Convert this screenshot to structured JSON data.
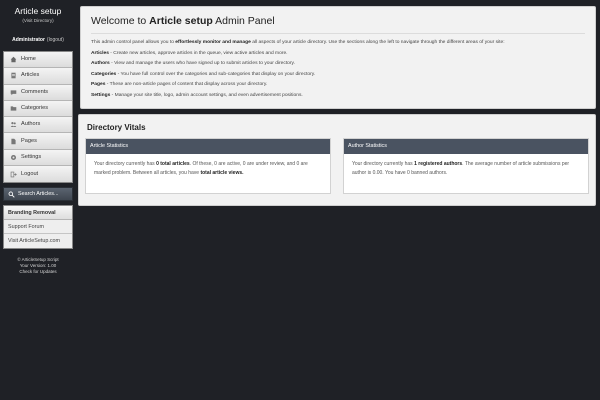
{
  "sidebar": {
    "title": "Article setup",
    "subtitle": "(Visit Directory)",
    "admin_label": "Administrator",
    "logout_label": "(logout)",
    "nav": [
      {
        "label": "Home",
        "icon": "home-icon"
      },
      {
        "label": "Articles",
        "icon": "document-icon"
      },
      {
        "label": "Comments",
        "icon": "comment-icon"
      },
      {
        "label": "Categories",
        "icon": "folder-icon"
      },
      {
        "label": "Authors",
        "icon": "users-icon"
      },
      {
        "label": "Pages",
        "icon": "page-icon"
      },
      {
        "label": "Settings",
        "icon": "gear-icon"
      },
      {
        "label": "Logout",
        "icon": "logout-icon"
      }
    ],
    "search_label": "Search Articles...",
    "branding": {
      "heading": "Branding Removal",
      "links": [
        "Support Forum",
        "Visit ArticleSetup.com"
      ]
    },
    "footer": {
      "copyright": "© ArticleSetup Script",
      "version": "Your Version: 1.00",
      "updates": "Check for Updates"
    }
  },
  "welcome": {
    "title_prefix": "Welcome to ",
    "title_brand": "Article setup",
    "title_suffix": " Admin Panel",
    "intro_prefix": "This admin control panel allows you to ",
    "intro_bold": "effortlessly monitor and manage",
    "intro_suffix": " all aspects of your article directory. Use the sections along the left to navigate through the different areas of your site:",
    "sections": [
      {
        "name": "Articles",
        "text": " - Create new articles, approve articles in the queue, view active articles and more."
      },
      {
        "name": "Authors",
        "text": " - View and manage the users who have signed up to submit articles to your directory."
      },
      {
        "name": "Categories",
        "text": " - You have full control over the categories and sub-categories that display on your directory."
      },
      {
        "name": "Pages",
        "text": " - These are non-article pages of content that display across your directory."
      },
      {
        "name": "Settings",
        "text": " - Manage your site title, logo, admin account settings, and even advertisement positions."
      }
    ]
  },
  "vitals": {
    "title": "Directory Vitals",
    "article_stats": {
      "heading": "Article Statistics",
      "p1": "Your directory currently has ",
      "b1": "0 total articles",
      "p2": ". Of these, 0 are active, 0 are under review, and 0 are marked problem. Between all articles, you have ",
      "b2": "total article views."
    },
    "author_stats": {
      "heading": "Author Statistics",
      "p1": "Your directory currently has ",
      "b1": "1 registered authors",
      "p2": ". The average number of article submissions per author is 0.00. You have 0 banned authors."
    }
  }
}
